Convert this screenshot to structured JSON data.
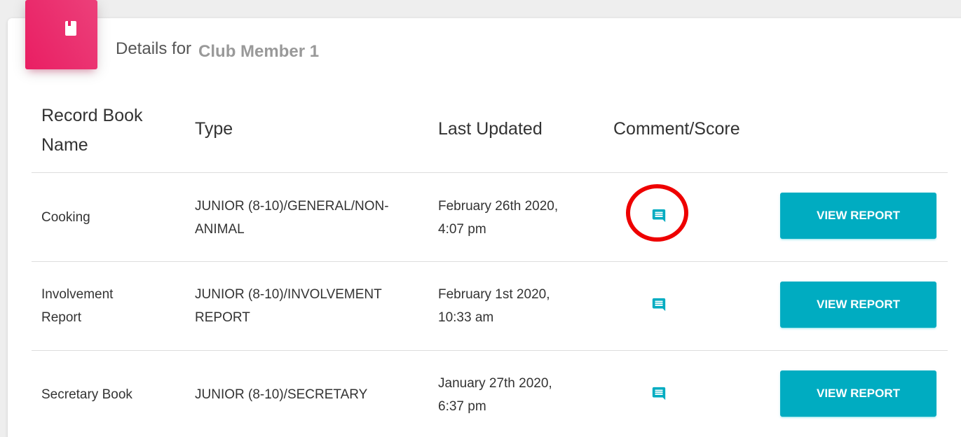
{
  "title": {
    "prefix": "Details for",
    "member_name": "Club Member 1"
  },
  "icon_name": "book-icon",
  "accent_color": "#e91e63",
  "button_color": "#00acc1",
  "annotation_color": "#ee0000",
  "table": {
    "headers": {
      "name": "Record Book\nName",
      "type": "Type",
      "last_updated": "Last Updated",
      "comment_score": "Comment/Score"
    },
    "rows": [
      {
        "name": "Cooking",
        "type": "JUNIOR (8-10)/GENERAL/NON-\nANIMAL",
        "last_updated": "February 26th 2020,\n4:07 pm",
        "comment_icon": "comment-icon",
        "button_label": "VIEW REPORT"
      },
      {
        "name": "Involvement\nReport",
        "type": "JUNIOR (8-10)/INVOLVEMENT\nREPORT",
        "last_updated": "February 1st 2020,\n10:33 am",
        "comment_icon": "comment-icon",
        "button_label": "VIEW REPORT"
      },
      {
        "name": "Secretary Book",
        "type": "JUNIOR (8-10)/SECRETARY",
        "last_updated": "January 27th 2020,\n6:37 pm",
        "comment_icon": "comment-icon",
        "button_label": "VIEW REPORT"
      }
    ]
  }
}
